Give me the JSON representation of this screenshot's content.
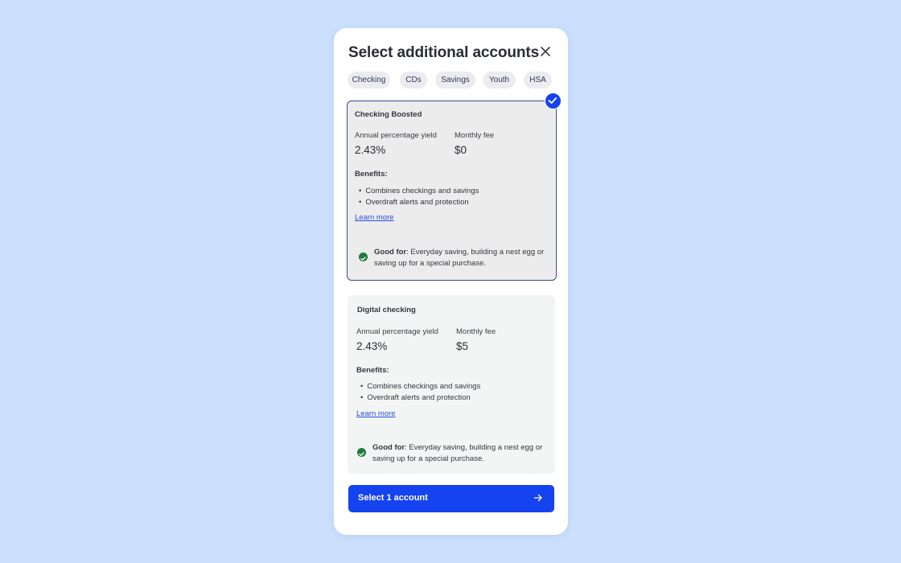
{
  "modal": {
    "title": "Select additional accounts",
    "close_icon": "close-icon"
  },
  "chips": [
    {
      "label": "Checking"
    },
    {
      "label": "CDs"
    },
    {
      "label": "Savings"
    },
    {
      "label": "Youth"
    },
    {
      "label": "HSA"
    }
  ],
  "accounts": [
    {
      "name": "Checking Boosted",
      "selected": true,
      "apy_label": "Annual percentage yield",
      "apy_value": "2.43%",
      "fee_label": "Monthly fee",
      "fee_value": "$0",
      "benefits_label": "Benefits:",
      "benefits": [
        "Combines checkings and savings",
        "Overdraft alerts and protection"
      ],
      "learn_more": "Learn more",
      "good_for_label": "Good for",
      "good_for_text": ": Everyday saving, building a nest egg or saving up for a special purchase."
    },
    {
      "name": "Digital checking",
      "selected": false,
      "apy_label": "Annual percentage yield",
      "apy_value": "2.43%",
      "fee_label": "Monthly fee",
      "fee_value": "$5",
      "benefits_label": "Benefits:",
      "benefits": [
        "Combines checkings and savings",
        "Overdraft alerts and protection"
      ],
      "learn_more": "Learn more",
      "good_for_label": "Good for",
      "good_for_text": ": Everyday saving, building a nest egg or saving up for a special purchase."
    }
  ],
  "cta": {
    "label": "Select 1 account",
    "icon": "arrow-right-icon"
  },
  "colors": {
    "background": "#cce0fe",
    "accent": "#1543f0",
    "selected_border": "#3a4f86",
    "good_for_check": "#1f7a3e"
  }
}
